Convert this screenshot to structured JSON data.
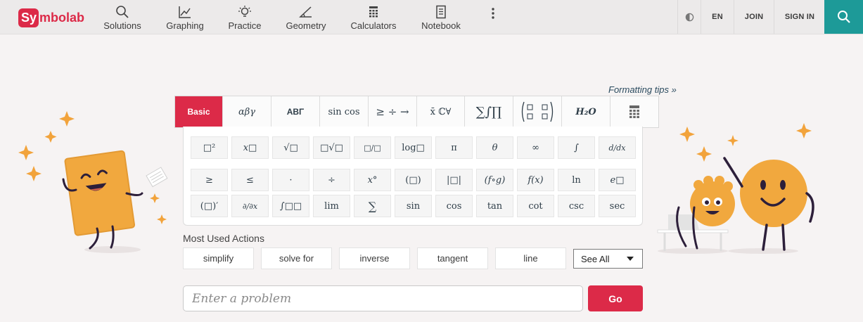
{
  "brand": {
    "logo_prefix": "Sy",
    "logo_rest": "mbolab",
    "accent_color": "#dc2a48",
    "teal_color": "#1d9a98"
  },
  "nav": {
    "items": [
      {
        "label": "Solutions",
        "icon": "search-icon"
      },
      {
        "label": "Graphing",
        "icon": "graph-icon"
      },
      {
        "label": "Practice",
        "icon": "lightbulb-icon"
      },
      {
        "label": "Geometry",
        "icon": "angle-icon"
      },
      {
        "label": "Calculators",
        "icon": "calculator-icon"
      },
      {
        "label": "Notebook",
        "icon": "notebook-icon"
      }
    ],
    "lang": "EN",
    "join": "JOIN",
    "sign_in": "SIGN IN"
  },
  "formatting_tips": "Formatting tips »",
  "tabs": [
    "Basic",
    "αβγ",
    "ABΓ",
    "sin cos",
    "≥ ÷ →",
    "x̄ ℂ∀",
    "∑∫∏",
    "( ▫ ▫ )",
    "H₂O",
    "calculator"
  ],
  "keys": {
    "row1": [
      "□²",
      "x□",
      "√□",
      "□√□",
      "□/□",
      "log□",
      "π",
      "θ",
      "∞",
      "∫",
      "d/dx"
    ],
    "row2": [
      "≥",
      "≤",
      "·",
      "÷",
      "x°",
      "(□)",
      "|□|",
      "(f∘g)",
      "f(x)",
      "ln",
      "e□"
    ],
    "row3": [
      "(□)′",
      "∂/∂x",
      "∫□□",
      "lim",
      "∑",
      "sin",
      "cos",
      "tan",
      "cot",
      "csc",
      "sec"
    ]
  },
  "most_used": {
    "title": "Most Used Actions",
    "actions": [
      "simplify",
      "solve for",
      "inverse",
      "tangent",
      "line"
    ],
    "see_all": "See All"
  },
  "input": {
    "placeholder": "Enter a problem"
  },
  "go_label": "Go"
}
